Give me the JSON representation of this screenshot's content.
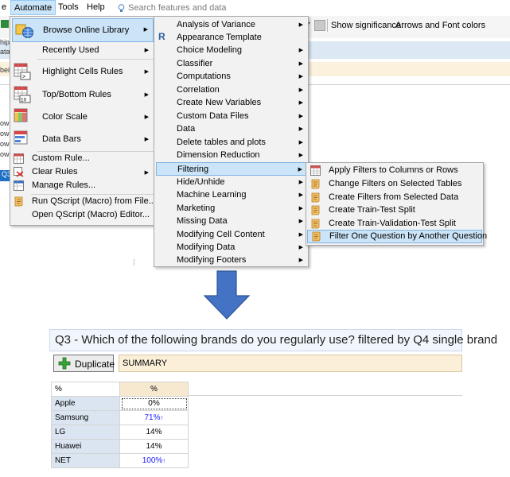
{
  "menubar": {
    "file_fragment": "e",
    "items": [
      "Automate",
      "Tools",
      "Help"
    ],
    "search_placeholder": "Search features and data"
  },
  "toolbar": {
    "significance_label": "Show significance:",
    "significance_value": "Arrows and Font colors"
  },
  "left_fragments": [
    "hip",
    "ata",
    "bei",
    "owi",
    "owi",
    "owi",
    "owi",
    "Q3"
  ],
  "automate_menu": {
    "items": [
      {
        "label": "Browse Online Library",
        "icon": "library-globe-icon",
        "submenu": true,
        "highlighted": true
      },
      {
        "label": "Recently Used",
        "submenu": true
      },
      {
        "label": "Highlight Cells Rules",
        "icon": "highlight-cells-icon",
        "submenu": true
      },
      {
        "label": "Top/Bottom Rules",
        "icon": "top-bottom-icon",
        "submenu": true
      },
      {
        "label": "Color Scale",
        "icon": "color-scale-icon",
        "submenu": true
      },
      {
        "label": "Data Bars",
        "icon": "data-bars-icon",
        "submenu": true
      },
      {
        "label": "Custom Rule...",
        "icon": "custom-rule-icon"
      },
      {
        "label": "Clear Rules",
        "icon": "clear-rules-icon",
        "submenu": true
      },
      {
        "label": "Manage Rules...",
        "icon": "manage-rules-icon"
      },
      {
        "label": "Run QScript (Macro) from File...",
        "icon": "script-icon"
      },
      {
        "label": "Open QScript (Macro) Editor..."
      }
    ]
  },
  "library_menu": {
    "items": [
      {
        "label": "Analysis of Variance",
        "submenu": true
      },
      {
        "label": "Appearance Template",
        "icon": "r-icon"
      },
      {
        "label": "Choice Modeling",
        "submenu": true
      },
      {
        "label": "Classifier",
        "submenu": true
      },
      {
        "label": "Computations",
        "submenu": true
      },
      {
        "label": "Correlation",
        "submenu": true
      },
      {
        "label": "Create New Variables",
        "submenu": true
      },
      {
        "label": "Custom Data Files",
        "submenu": true
      },
      {
        "label": "Data",
        "submenu": true
      },
      {
        "label": "Delete tables and plots",
        "submenu": true
      },
      {
        "label": "Dimension Reduction",
        "submenu": true
      },
      {
        "label": "Filtering",
        "submenu": true,
        "highlighted": true
      },
      {
        "label": "Hide/Unhide",
        "submenu": true
      },
      {
        "label": "Machine Learning",
        "submenu": true
      },
      {
        "label": "Marketing",
        "submenu": true
      },
      {
        "label": "Missing Data",
        "submenu": true
      },
      {
        "label": "Modifying Cell Content",
        "submenu": true
      },
      {
        "label": "Modifying Data",
        "submenu": true
      },
      {
        "label": "Modifying Footers",
        "submenu": true
      }
    ]
  },
  "filtering_menu": {
    "items": [
      {
        "label": "Apply Filters to Columns or Rows",
        "icon": "table-filter-icon"
      },
      {
        "label": "Change Filters on Selected Tables",
        "icon": "scroll-icon"
      },
      {
        "label": "Create Filters from Selected Data",
        "icon": "scroll-icon"
      },
      {
        "label": "Create Train-Test Split",
        "icon": "scroll-icon"
      },
      {
        "label": "Create Train-Validation-Test Split",
        "icon": "scroll-icon"
      },
      {
        "label": "Filter One Question by Another Question",
        "icon": "scroll-icon",
        "highlighted": true
      }
    ]
  },
  "result": {
    "title": "Q3 - Which of the following brands do you regularly use? filtered by Q4 single brand",
    "duplicate_label": "Duplicate",
    "summary_label": "SUMMARY",
    "table": {
      "corner": "%",
      "column_header": "%",
      "rows": [
        {
          "label": "Apple",
          "value": "0%",
          "sig": "",
          "blue": false
        },
        {
          "label": "Samsung",
          "value": "71%",
          "sig": "↑",
          "blue": true
        },
        {
          "label": "LG",
          "value": "14%",
          "sig": "",
          "blue": false
        },
        {
          "label": "Huawei",
          "value": "14%",
          "sig": "",
          "blue": false
        },
        {
          "label": "NET",
          "value": "100%",
          "sig": "↑",
          "blue": true
        }
      ]
    }
  },
  "colors": {
    "menu_highlight": "#cce4f7",
    "arrow_blue": "#4472c4",
    "significance_blue": "#1a1aff"
  }
}
